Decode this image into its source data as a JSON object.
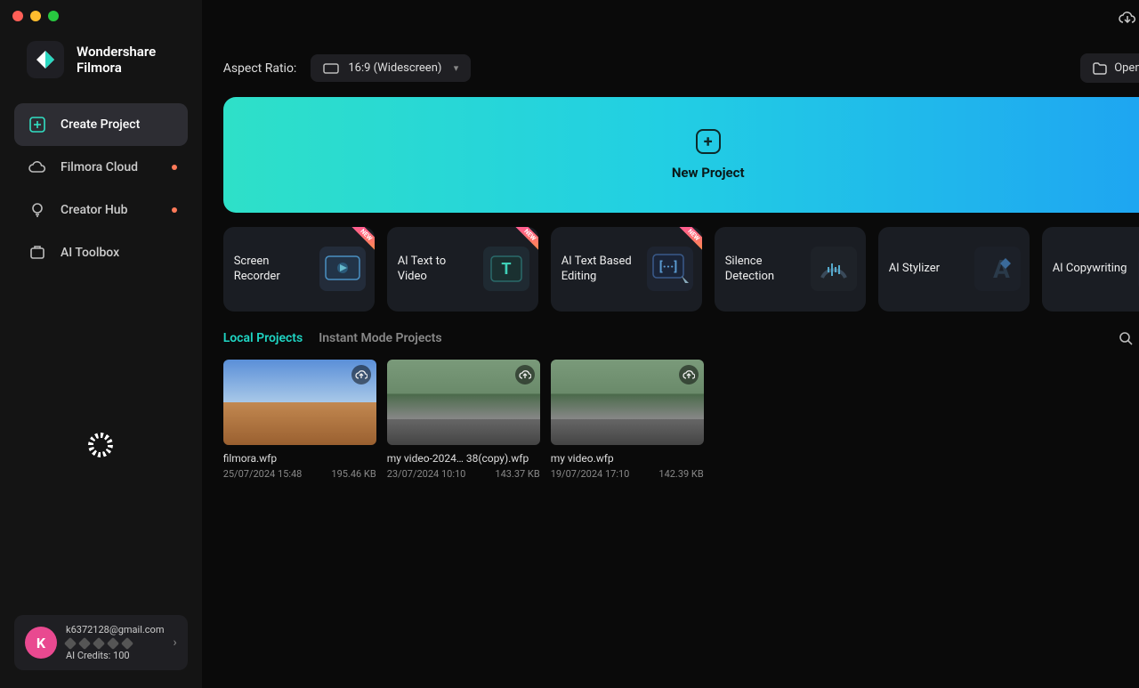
{
  "brand": {
    "line1": "Wondershare",
    "line2": "Filmora"
  },
  "nav": {
    "create": "Create Project",
    "cloud": "Filmora Cloud",
    "hub": "Creator Hub",
    "toolbox": "AI Toolbox"
  },
  "account": {
    "initial": "K",
    "email": "k6372128@gmail.com",
    "credits": "AI Credits: 100"
  },
  "toprow": {
    "ar_label": "Aspect Ratio:",
    "ar_value": "16:9 (Widescreen)",
    "open": "Open Project"
  },
  "newproject": {
    "label": "New Project"
  },
  "tools": [
    {
      "label": "Screen Recorder",
      "new": true,
      "icon": "screen-recorder-icon",
      "bg": "#232c3a"
    },
    {
      "label": "AI Text to Video",
      "new": true,
      "icon": "text-to-video-icon",
      "bg": "#1f2a32"
    },
    {
      "label": "AI Text Based Editing",
      "new": true,
      "icon": "text-editing-icon",
      "bg": "#1e2430"
    },
    {
      "label": "Silence Detection",
      "new": false,
      "icon": "silence-icon",
      "bg": "#1e2228"
    },
    {
      "label": "AI Stylizer",
      "new": false,
      "icon": "stylizer-icon",
      "bg": "#1c2028"
    },
    {
      "label": "AI Copywriting",
      "new": false,
      "icon": "copywriting-icon",
      "bg": "#1c2028"
    }
  ],
  "tabs": {
    "local": "Local Projects",
    "instant": "Instant Mode Projects"
  },
  "projects": [
    {
      "name": "filmora.wfp",
      "date": "25/07/2024 15:48",
      "size": "195.46 KB",
      "thumb": "desert"
    },
    {
      "name": "my video-2024… 38(copy).wfp",
      "date": "23/07/2024 10:10",
      "size": "143.37 KB",
      "thumb": "road"
    },
    {
      "name": "my video.wfp",
      "date": "19/07/2024 17:10",
      "size": "142.39 KB",
      "thumb": "road"
    }
  ]
}
